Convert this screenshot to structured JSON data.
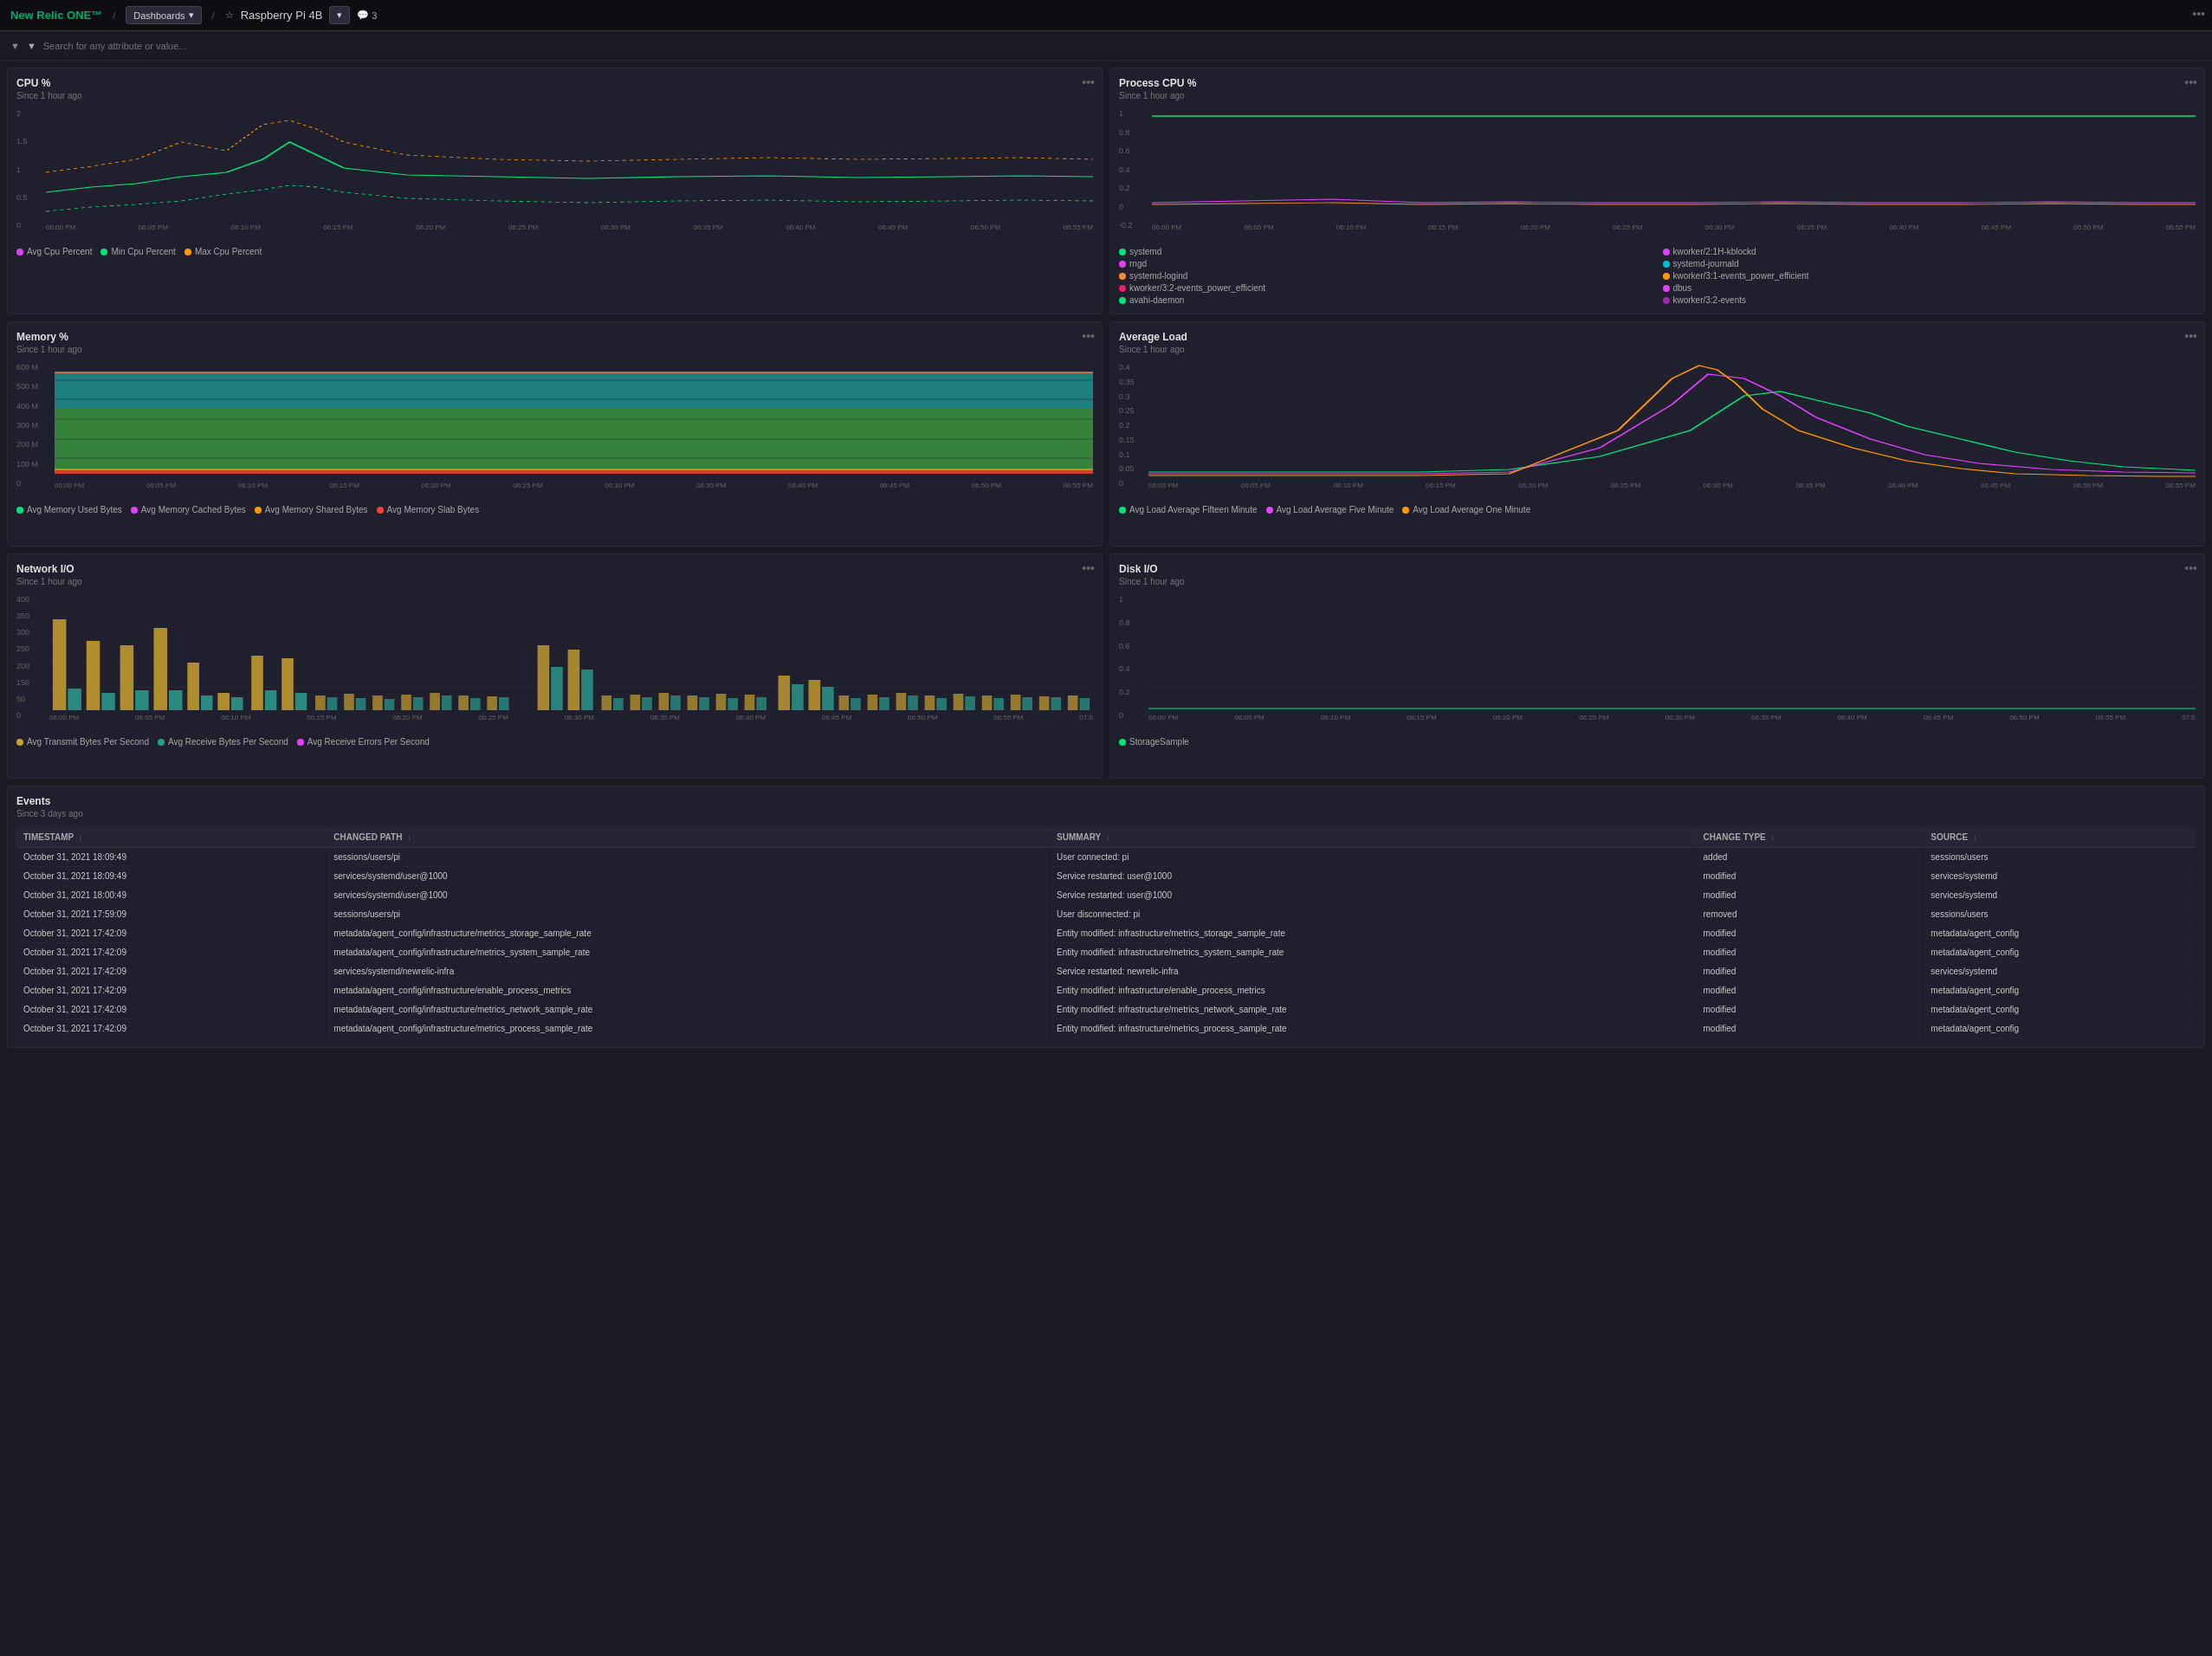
{
  "header": {
    "logo": "New Relic ONE™",
    "nav_sep": "/",
    "dashboards_label": "Dashboards",
    "breadcrumb_sep": "/",
    "page_name": "Raspberry Pi 4B",
    "comment_icon": "💬",
    "comment_count": "3"
  },
  "filter_bar": {
    "placeholder": "Search for any attribute or value..."
  },
  "panels": {
    "cpu": {
      "title": "CPU %",
      "subtitle": "Since 1 hour ago",
      "y_values": [
        "2",
        "1.5",
        "1",
        "0.5",
        "0"
      ],
      "x_labels": [
        "06:00 PM",
        "06:05 PM",
        "06:10 PM",
        "06:15 PM",
        "06:20 PM",
        "06:25 PM",
        "06:30 PM",
        "06:35 PM",
        "06:40 PM",
        "06:45 PM",
        "06:50 PM",
        "06:55 PM"
      ],
      "legend": [
        {
          "label": "Avg Cpu Percent",
          "color": "#e040fb"
        },
        {
          "label": "Min Cpu Percent",
          "color": "#00e676"
        },
        {
          "label": "Max Cpu Percent",
          "color": "#ff9800"
        }
      ]
    },
    "process_cpu": {
      "title": "Process CPU %",
      "subtitle": "Since 1 hour ago",
      "x_labels": [
        "06:00 PM",
        "06:05 PM",
        "06:10 PM",
        "06:15 PM",
        "06:20 PM",
        "06:25 PM",
        "06:30 PM",
        "06:35 PM",
        "06:40 PM",
        "06:45 PM",
        "06:50 PM",
        "06:55 PM"
      ],
      "y_values": [
        "1",
        "0.8",
        "0.6",
        "0.4",
        "0.2",
        "0",
        "-0.2"
      ],
      "legend": [
        {
          "label": "systemd",
          "color": "#00e676"
        },
        {
          "label": "rngd",
          "color": "#e040fb"
        },
        {
          "label": "systemd-logind",
          "color": "#f48e2f"
        },
        {
          "label": "kworker/2:1H-kblockd",
          "color": "#e040fb"
        },
        {
          "label": "systemd-journald",
          "color": "#00bcd4"
        },
        {
          "label": "kworker/3:1-events_power_efficient",
          "color": "#ff9800"
        },
        {
          "label": "kworker/3:2-events_power_efficient",
          "color": "#e91e63"
        },
        {
          "label": "dbus",
          "color": "#e040fb"
        },
        {
          "label": "avahi-daemon",
          "color": "#00e676"
        },
        {
          "label": "kworker/3:2-events",
          "color": "#9c27b0"
        }
      ]
    },
    "memory": {
      "title": "Memory %",
      "subtitle": "Since 1 hour ago",
      "y_values": [
        "600 M",
        "500 M",
        "400 M",
        "300 M",
        "200 M",
        "100 M",
        "0"
      ],
      "x_labels": [
        "06:00 PM",
        "06:05 PM",
        "06:10 PM",
        "06:15 PM",
        "06:20 PM",
        "06:25 PM",
        "06:30 PM",
        "06:35 PM",
        "06:40 PM",
        "06:45 PM",
        "06:50 PM",
        "06:55 PM"
      ],
      "legend": [
        {
          "label": "Avg Memory Used Bytes",
          "color": "#00e676"
        },
        {
          "label": "Avg Memory Cached Bytes",
          "color": "#e040fb"
        },
        {
          "label": "Avg Memory Shared Bytes",
          "color": "#ff9800"
        },
        {
          "label": "Avg Memory Slab Bytes",
          "color": "#f44336"
        }
      ]
    },
    "average_load": {
      "title": "Average Load",
      "subtitle": "Since 1 hour ago",
      "y_values": [
        "0.4",
        "0.35",
        "0.3",
        "0.25",
        "0.2",
        "0.15",
        "0.1",
        "0.05",
        "0"
      ],
      "x_labels": [
        "06:00 PM",
        "06:05 PM",
        "06:10 PM",
        "06:15 PM",
        "06:20 PM",
        "06:25 PM",
        "06:30 PM",
        "06:35 PM",
        "06:40 PM",
        "06:45 PM",
        "06:50 PM",
        "06:55 PM"
      ],
      "legend": [
        {
          "label": "Avg Load Average Fifteen Minute",
          "color": "#00e676"
        },
        {
          "label": "Avg Load Average Five Minute",
          "color": "#e040fb"
        },
        {
          "label": "Avg Load Average One Minute",
          "color": "#ff9800"
        }
      ]
    },
    "network_io": {
      "title": "Network I/O",
      "subtitle": "Since 1 hour ago",
      "y_values": [
        "400",
        "350",
        "300",
        "250",
        "200",
        "150",
        "50",
        "0"
      ],
      "x_labels": [
        "06:00 PM",
        "06:05 PM",
        "06:10 PM",
        "06:15 PM",
        "06:20 PM",
        "06:25 PM",
        "06:30 PM",
        "06:35 PM",
        "06:40 PM",
        "06:45 PM",
        "06:50 PM",
        "06:55 PM",
        "07:0"
      ],
      "legend": [
        {
          "label": "Avg Transmit Bytes Per Second",
          "color": "#c8a030"
        },
        {
          "label": "Avg Receive Bytes Per Second",
          "color": "#2a9d8f"
        },
        {
          "label": "Avg Receive Errors Per Second",
          "color": "#e040fb"
        }
      ]
    },
    "disk_io": {
      "title": "Disk I/O",
      "subtitle": "Since 1 hour ago",
      "y_values": [
        "1",
        "0.8",
        "0.6",
        "0.4",
        "0.2",
        "0"
      ],
      "x_labels": [
        "06:00 PM",
        "06:05 PM",
        "06:10 PM",
        "06:15 PM",
        "06:20 PM",
        "06:25 PM",
        "06:30 PM",
        "06:35 PM",
        "06:40 PM",
        "06:45 PM",
        "06:50 PM",
        "06:55 PM",
        "07:0"
      ],
      "legend": [
        {
          "label": "StorageSample",
          "color": "#00e676"
        }
      ]
    }
  },
  "events": {
    "title": "Events",
    "subtitle": "Since 3 days ago",
    "columns": [
      "TIMESTAMP",
      "CHANGED PATH",
      "SUMMARY",
      "CHANGE TYPE",
      "SOURCE"
    ],
    "rows": [
      {
        "timestamp": "October 31, 2021 18:09:49",
        "changed_path": "sessions/users/pi",
        "summary": "User connected: pi",
        "change_type": "added",
        "source": "sessions/users"
      },
      {
        "timestamp": "October 31, 2021 18:09:49",
        "changed_path": "services/systemd/user@1000",
        "summary": "Service restarted: user@1000",
        "change_type": "modified",
        "source": "services/systemd"
      },
      {
        "timestamp": "October 31, 2021 18:00:49",
        "changed_path": "services/systemd/user@1000",
        "summary": "Service restarted: user@1000",
        "change_type": "modified",
        "source": "services/systemd"
      },
      {
        "timestamp": "October 31, 2021 17:59:09",
        "changed_path": "sessions/users/pi",
        "summary": "User disconnected: pi",
        "change_type": "removed",
        "source": "sessions/users"
      },
      {
        "timestamp": "October 31, 2021 17:42:09",
        "changed_path": "metadata/agent_config/infrastructure/metrics_storage_sample_rate",
        "summary": "Entity modified: infrastructure/metrics_storage_sample_rate",
        "change_type": "modified",
        "source": "metadata/agent_config"
      },
      {
        "timestamp": "October 31, 2021 17:42:09",
        "changed_path": "metadata/agent_config/infrastructure/metrics_system_sample_rate",
        "summary": "Entity modified: infrastructure/metrics_system_sample_rate",
        "change_type": "modified",
        "source": "metadata/agent_config"
      },
      {
        "timestamp": "October 31, 2021 17:42:09",
        "changed_path": "services/systemd/newrelic-infra",
        "summary": "Service restarted: newrelic-infra",
        "change_type": "modified",
        "source": "services/systemd"
      },
      {
        "timestamp": "October 31, 2021 17:42:09",
        "changed_path": "metadata/agent_config/infrastructure/enable_process_metrics",
        "summary": "Entity modified: infrastructure/enable_process_metrics",
        "change_type": "modified",
        "source": "metadata/agent_config"
      },
      {
        "timestamp": "October 31, 2021 17:42:09",
        "changed_path": "metadata/agent_config/infrastructure/metrics_network_sample_rate",
        "summary": "Entity modified: infrastructure/metrics_network_sample_rate",
        "change_type": "modified",
        "source": "metadata/agent_config"
      },
      {
        "timestamp": "October 31, 2021 17:42:09",
        "changed_path": "metadata/agent_config/infrastructure/metrics_process_sample_rate",
        "summary": "Entity modified: infrastructure/metrics_process_sample_rate",
        "change_type": "modified",
        "source": "metadata/agent_config"
      }
    ]
  }
}
